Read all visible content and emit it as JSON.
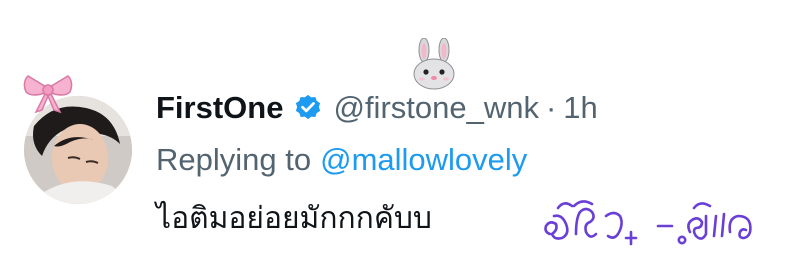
{
  "tweet": {
    "display_name": "FirstOne",
    "handle": "@firstone_wnk",
    "separator": "·",
    "time": "1h",
    "reply_prefix": "Replying to",
    "reply_mention": "@mallowlovely",
    "text": "ไอติมอย่อยมักกกคับบ",
    "handwritten_note": "ฉื้วฯ -ฺวีใ"
  },
  "icons": {
    "verified": "verified-badge-icon",
    "bow": "pink-bow-sticker",
    "bunny": "bunny-face-sticker"
  },
  "colors": {
    "name": "#0f1419",
    "secondary": "#536471",
    "accent": "#1d9bf0",
    "handwriting": "#6a3fd6",
    "bow": "#f6a6c8"
  }
}
